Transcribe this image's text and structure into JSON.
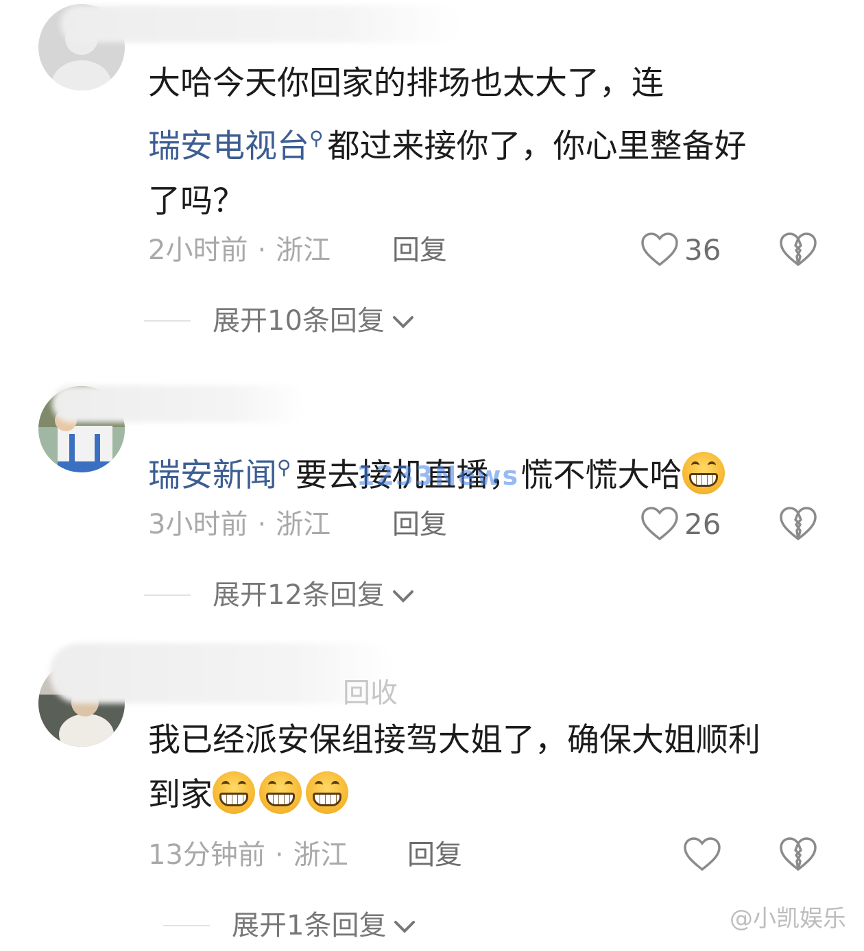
{
  "comments": [
    {
      "text_lines": [
        "大哈今天你回家的排场也太大了，连",
        "都过来接你了，你心里整备好",
        "了吗？"
      ],
      "mention": "瑞安电视台",
      "time": "2小时前",
      "location": "浙江",
      "reply_label": "回复",
      "likes": "36",
      "expand_label": "展开10条回复"
    },
    {
      "mention": "瑞安新闻",
      "text": "要去接机直播，慌不慌大哈",
      "time": "3小时前",
      "location": "浙江",
      "reply_label": "回复",
      "likes": "26",
      "expand_label": "展开12条回复"
    },
    {
      "partial_name": "回收",
      "text_lines": [
        "我已经派安保组接驾大姐了，确保大姐顺利",
        "到家"
      ],
      "time": "13分钟前",
      "location": "浙江",
      "reply_label": "回复",
      "likes": "",
      "expand_label": "展开1条回复"
    }
  ],
  "separator": "·",
  "watermark": "1233News",
  "source_mark": "@小凯娱乐",
  "icons": {
    "like": "heart-outline-icon",
    "dislike": "broken-heart-icon",
    "mention": "search-icon",
    "emoji": "grinning-face-icon",
    "expand": "chevron-down-icon"
  },
  "colors": {
    "mention": "#3d5e93",
    "text": "#1b1b1b",
    "meta": "#a9a9a9",
    "reply": "#6e6e6e"
  }
}
